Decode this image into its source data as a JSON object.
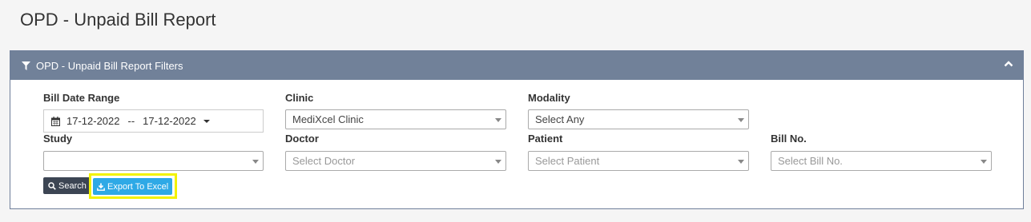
{
  "page": {
    "title": "OPD - Unpaid Bill Report"
  },
  "panel": {
    "title": "OPD - Unpaid Bill Report Filters"
  },
  "filters": {
    "bill_date_range": {
      "label": "Bill Date Range",
      "from": "17-12-2022",
      "separator": "--",
      "to": "17-12-2022"
    },
    "clinic": {
      "label": "Clinic",
      "value": "MediXcel Clinic"
    },
    "modality": {
      "label": "Modality",
      "value": "Select Any"
    },
    "study": {
      "label": "Study",
      "value": ""
    },
    "doctor": {
      "label": "Doctor",
      "placeholder": "Select Doctor"
    },
    "patient": {
      "label": "Patient",
      "placeholder": "Select Patient"
    },
    "bill_no": {
      "label": "Bill No.",
      "placeholder": "Select Bill No."
    }
  },
  "buttons": {
    "search": "Search",
    "export": "Export To Excel"
  },
  "colors": {
    "header": "#718199",
    "export": "#2ea9e6",
    "search": "#3c4553",
    "highlight": "#f2f200"
  },
  "icons": {
    "panel": "filter-icon",
    "collapse": "chevron-up-icon",
    "date": "calendar-icon",
    "search": "search-icon",
    "export": "download-icon"
  }
}
